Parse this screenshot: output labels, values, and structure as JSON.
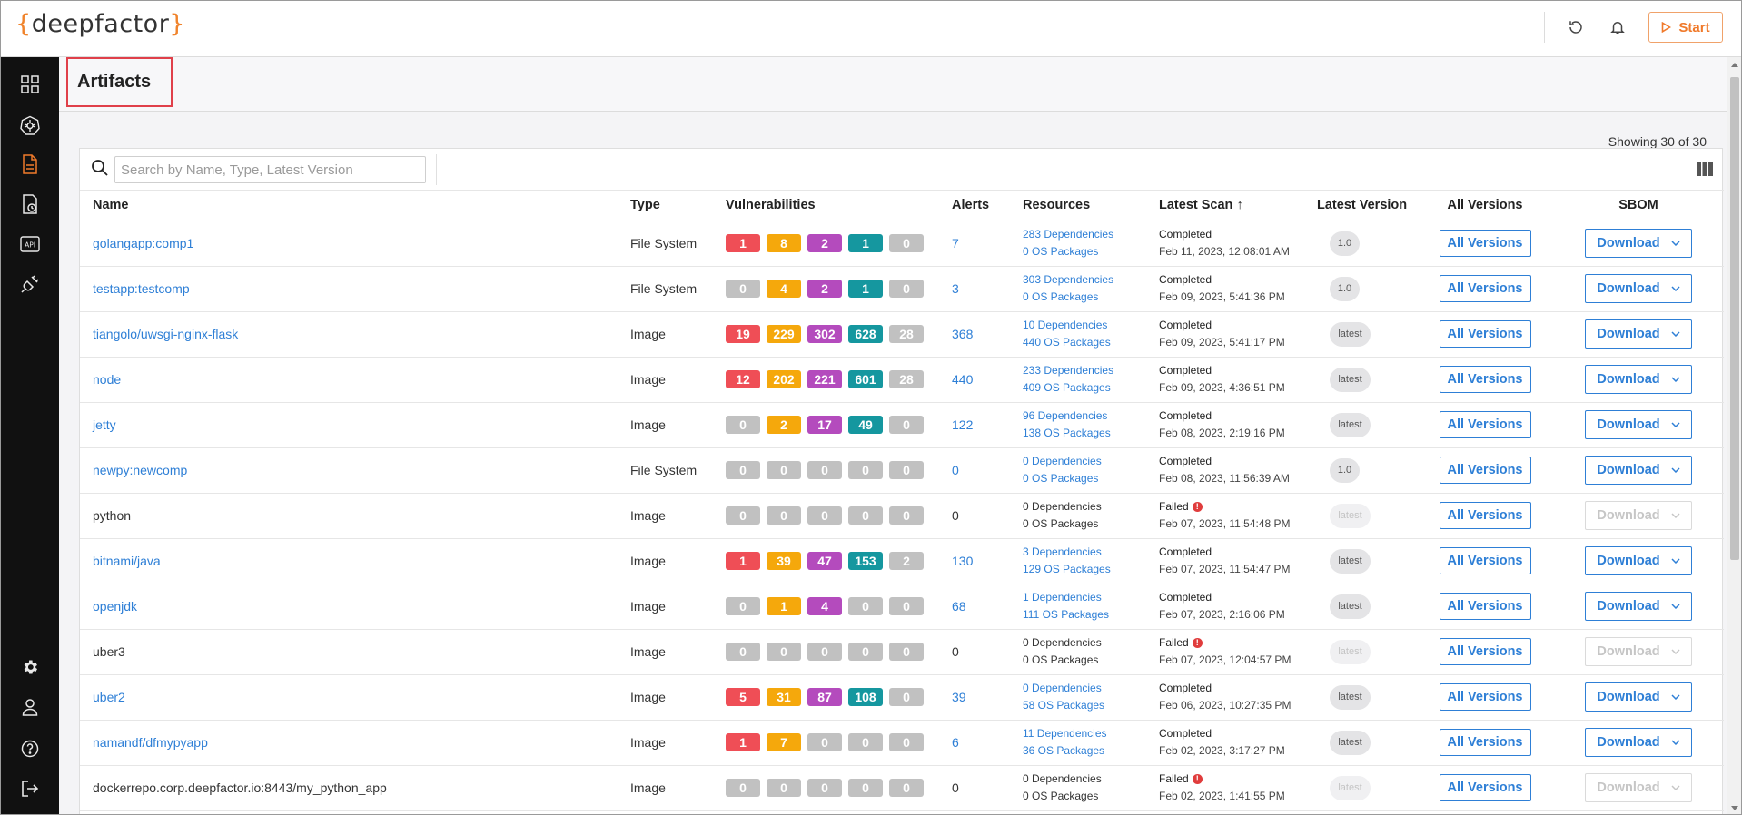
{
  "app": {
    "logo_open": "{",
    "logo_text": "deepfactor",
    "logo_close": "}",
    "start_label": "Start",
    "colors": {
      "accent": "#f07a2b",
      "link": "#2e7fd6",
      "sidebar": "#111111"
    }
  },
  "sidebar": {
    "items": [
      {
        "name": "dashboard-icon"
      },
      {
        "name": "kubernetes-icon"
      },
      {
        "name": "artifacts-icon",
        "active": true
      },
      {
        "name": "application-icon"
      },
      {
        "name": "api-icon"
      },
      {
        "name": "integrations-icon"
      }
    ],
    "bottom": [
      {
        "name": "settings-icon"
      },
      {
        "name": "user-icon"
      },
      {
        "name": "help-icon"
      },
      {
        "name": "logout-icon"
      }
    ]
  },
  "page": {
    "title": "Artifacts",
    "showing": "Showing 30 of 30"
  },
  "search": {
    "placeholder": "Search by Name, Type, Latest Version",
    "value": ""
  },
  "columns": {
    "name": "Name",
    "type": "Type",
    "vulnerabilities": "Vulnerabilities",
    "alerts": "Alerts",
    "resources": "Resources",
    "latest_scan": "Latest Scan",
    "latest_scan_sort": "↑",
    "latest_version": "Latest Version",
    "all_versions": "All Versions",
    "sbom": "SBOM"
  },
  "severity_colors": [
    "#ef4e56",
    "#f5a80c",
    "#b44bbd",
    "#15979f",
    "#c1c1c1"
  ],
  "button_labels": {
    "all_versions": "All Versions",
    "download": "Download"
  },
  "rows": [
    {
      "name": "golangapp:comp1",
      "link": true,
      "type": "File System",
      "vulns": [
        1,
        8,
        2,
        1,
        0
      ],
      "alerts": "7",
      "deps": "283 Dependencies",
      "os": "0 OS Packages",
      "status": "Completed",
      "failed": false,
      "date": "Feb 11, 2023, 12:08:01 AM",
      "version": "1.0",
      "enabled": true
    },
    {
      "name": "testapp:testcomp",
      "link": true,
      "type": "File System",
      "vulns": [
        0,
        4,
        2,
        1,
        0
      ],
      "alerts": "3",
      "deps": "303 Dependencies",
      "os": "0 OS Packages",
      "status": "Completed",
      "failed": false,
      "date": "Feb 09, 2023, 5:41:36 PM",
      "version": "1.0",
      "enabled": true
    },
    {
      "name": "tiangolo/uwsgi-nginx-flask",
      "link": true,
      "type": "Image",
      "vulns": [
        19,
        229,
        302,
        628,
        28
      ],
      "alerts": "368",
      "deps": "10 Dependencies",
      "os": "440 OS Packages",
      "status": "Completed",
      "failed": false,
      "date": "Feb 09, 2023, 5:41:17 PM",
      "version": "latest",
      "enabled": true
    },
    {
      "name": "node",
      "link": true,
      "type": "Image",
      "vulns": [
        12,
        202,
        221,
        601,
        28
      ],
      "alerts": "440",
      "deps": "233 Dependencies",
      "os": "409 OS Packages",
      "status": "Completed",
      "failed": false,
      "date": "Feb 09, 2023, 4:36:51 PM",
      "version": "latest",
      "enabled": true
    },
    {
      "name": "jetty",
      "link": true,
      "type": "Image",
      "vulns": [
        0,
        2,
        17,
        49,
        0
      ],
      "alerts": "122",
      "deps": "96 Dependencies",
      "os": "138 OS Packages",
      "status": "Completed",
      "failed": false,
      "date": "Feb 08, 2023, 2:19:16 PM",
      "version": "latest",
      "enabled": true
    },
    {
      "name": "newpy:newcomp",
      "link": true,
      "type": "File System",
      "vulns": [
        0,
        0,
        0,
        0,
        0
      ],
      "alerts": "0",
      "deps": "0 Dependencies",
      "os": "0 OS Packages",
      "status": "Completed",
      "failed": false,
      "date": "Feb 08, 2023, 11:56:39 AM",
      "version": "1.0",
      "enabled": true
    },
    {
      "name": "python",
      "link": false,
      "type": "Image",
      "vulns": [
        0,
        0,
        0,
        0,
        0
      ],
      "alerts": "0",
      "deps": "0 Dependencies",
      "os": "0 OS Packages",
      "status": "Failed",
      "failed": true,
      "date": "Feb 07, 2023, 11:54:48 PM",
      "version": "latest",
      "enabled": false
    },
    {
      "name": "bitnami/java",
      "link": true,
      "type": "Image",
      "vulns": [
        1,
        39,
        47,
        153,
        2
      ],
      "alerts": "130",
      "deps": "3 Dependencies",
      "os": "129 OS Packages",
      "status": "Completed",
      "failed": false,
      "date": "Feb 07, 2023, 11:54:47 PM",
      "version": "latest",
      "enabled": true
    },
    {
      "name": "openjdk",
      "link": true,
      "type": "Image",
      "vulns": [
        0,
        1,
        4,
        0,
        0
      ],
      "alerts": "68",
      "deps": "1 Dependencies",
      "os": "111 OS Packages",
      "status": "Completed",
      "failed": false,
      "date": "Feb 07, 2023, 2:16:06 PM",
      "version": "latest",
      "enabled": true
    },
    {
      "name": "uber3",
      "link": false,
      "type": "Image",
      "vulns": [
        0,
        0,
        0,
        0,
        0
      ],
      "alerts": "0",
      "deps": "0 Dependencies",
      "os": "0 OS Packages",
      "status": "Failed",
      "failed": true,
      "date": "Feb 07, 2023, 12:04:57 PM",
      "version": "latest",
      "enabled": false
    },
    {
      "name": "uber2",
      "link": true,
      "type": "Image",
      "vulns": [
        5,
        31,
        87,
        108,
        0
      ],
      "alerts": "39",
      "deps": "0 Dependencies",
      "os": "58 OS Packages",
      "status": "Completed",
      "failed": false,
      "date": "Feb 06, 2023, 10:27:35 PM",
      "version": "latest",
      "enabled": true
    },
    {
      "name": "namandf/dfmypyapp",
      "link": true,
      "type": "Image",
      "vulns": [
        1,
        7,
        0,
        0,
        0
      ],
      "alerts": "6",
      "deps": "11 Dependencies",
      "os": "36 OS Packages",
      "status": "Completed",
      "failed": false,
      "date": "Feb 02, 2023, 3:17:27 PM",
      "version": "latest",
      "enabled": true
    },
    {
      "name": "dockerrepo.corp.deepfactor.io:8443/my_python_app",
      "link": false,
      "type": "Image",
      "vulns": [
        0,
        0,
        0,
        0,
        0
      ],
      "alerts": "0",
      "deps": "0 Dependencies",
      "os": "0 OS Packages",
      "status": "Failed",
      "failed": true,
      "date": "Feb 02, 2023, 1:41:55 PM",
      "version": "latest",
      "enabled": false
    }
  ]
}
